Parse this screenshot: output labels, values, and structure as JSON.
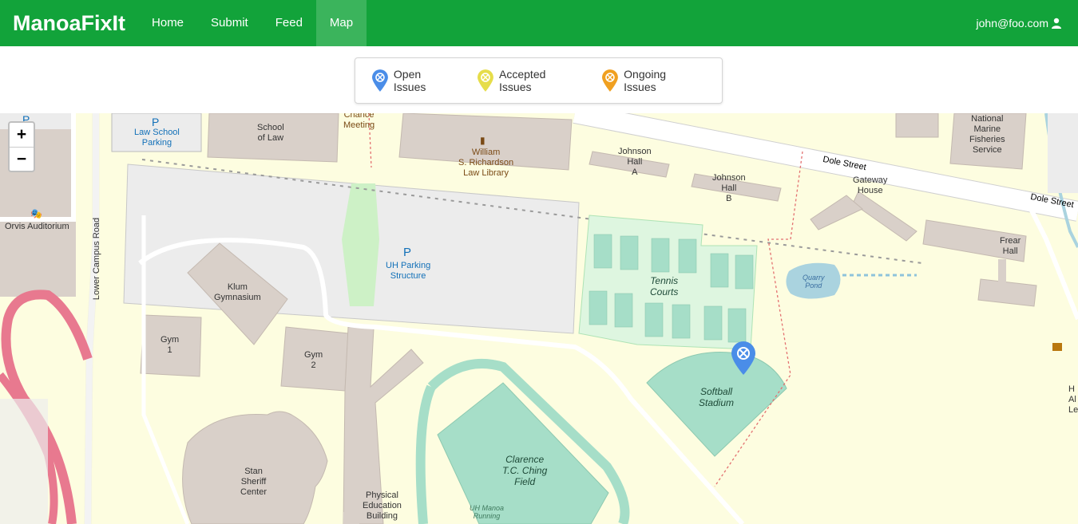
{
  "navbar": {
    "brand": "ManoaFixIt",
    "items": [
      {
        "label": "Home"
      },
      {
        "label": "Submit"
      },
      {
        "label": "Feed"
      },
      {
        "label": "Map"
      }
    ],
    "active": "Map",
    "user": "john@foo.com"
  },
  "legend": {
    "items": [
      {
        "label": "Open Issues",
        "color": "#4a8de8"
      },
      {
        "label": "Accepted Issues",
        "color": "#e6dd4a"
      },
      {
        "label": "Ongoing Issues",
        "color": "#f0a020"
      }
    ]
  },
  "map": {
    "zoom_in": "+",
    "zoom_out": "−",
    "labels": {
      "school_of_law": "School\nof Law",
      "law_library": "William\nS. Richardson\nLaw Library",
      "chance_meeting": "Chance\nMeeting",
      "law_school_parking": "Law School\nParking",
      "parking_p": "P",
      "johnson_a": "Johnson\nHall\nA",
      "johnson_b": "Johnson\nHall\nB",
      "dole_street": "Dole Street",
      "dole_street_2": "Dole Street",
      "gateway_house": "Gateway\nHouse",
      "national_marine": "National\nMarine\nFisheries\nService",
      "frear_hall": "Frear\nHall",
      "quarry_pond": "Quarry\nPond",
      "orvis": "Orvis Auditorium",
      "lower_campus_road": "Lower Campus Road",
      "uh_parking": "UH Parking\nStructure",
      "klum_gym": "Klum\nGymnasium",
      "gym1": "Gym\n1",
      "gym2": "Gym\n2",
      "tennis_courts": "Tennis\nCourts",
      "softball_stadium": "Softball\nStadium",
      "stan_sheriff": "Stan\nSheriff\nCenter",
      "physical_education": "Physical\nEducation\nBuilding",
      "clarence_field": "Clarence\nT.C. Ching\nField",
      "uh_manoa_running": "UH Manoa\nRunning",
      "right_edge_label": "H\nAl\nLe"
    },
    "markers": [
      {
        "type": "open-issue",
        "color": "#4a8de8"
      }
    ]
  }
}
